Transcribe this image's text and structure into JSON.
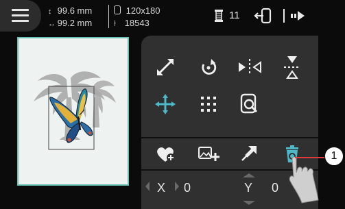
{
  "topbar": {
    "height_label": "99.6 mm",
    "width_label": "99.2 mm",
    "hoop_size": "120x180",
    "stitch_count": "18543",
    "thread_count": "11",
    "icons": [
      "menu-icon",
      "height-arrow-icon",
      "width-arrow-icon",
      "hoop-icon",
      "needle-icon",
      "spool-icon",
      "hoop-exit-icon",
      "next-arrow-icon"
    ]
  },
  "edit_panel": {
    "buttons": [
      "resize",
      "rotate",
      "flip-horizontal",
      "flip-vertical",
      "move",
      "stitch-grid",
      "hoop-zoom",
      "add-favorite",
      "add-pattern",
      "pin",
      "delete"
    ]
  },
  "position": {
    "x_label": "X",
    "x_value": "0",
    "y_label": "Y",
    "y_value": "0"
  },
  "callout": {
    "number": "1"
  },
  "colors": {
    "accent": "#4cb8c8",
    "hoop_border": "#67c2b4",
    "callout_line": "#e33b3b"
  }
}
